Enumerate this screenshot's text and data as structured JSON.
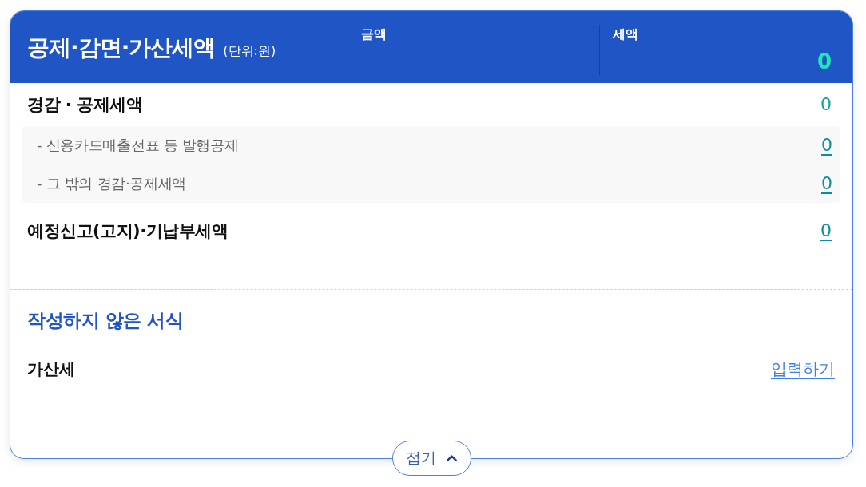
{
  "header": {
    "title": "공제·감면·가산세액",
    "unit": "(단위:원)",
    "columns": [
      {
        "label": "금액"
      },
      {
        "label": "세액",
        "value": "0"
      }
    ]
  },
  "rows": [
    {
      "kind": "plain",
      "label": "경감 · 공제세액",
      "value": "0",
      "children": [
        {
          "kind": "link",
          "label": "- 신용카드매출전표 등 발행공제",
          "value": "0"
        },
        {
          "kind": "link",
          "label": "- 그 밖의 경감·공제세액",
          "value": "0"
        }
      ]
    },
    {
      "kind": "link",
      "label": "예정신고(고지)·기납부세액",
      "value": "0"
    }
  ],
  "unfilled_forms": {
    "title": "작성하지 않은 서식",
    "items": [
      {
        "label": "가산세",
        "action": "입력하기"
      }
    ]
  },
  "collapse_button": {
    "label": "접기",
    "expanded": true
  }
}
